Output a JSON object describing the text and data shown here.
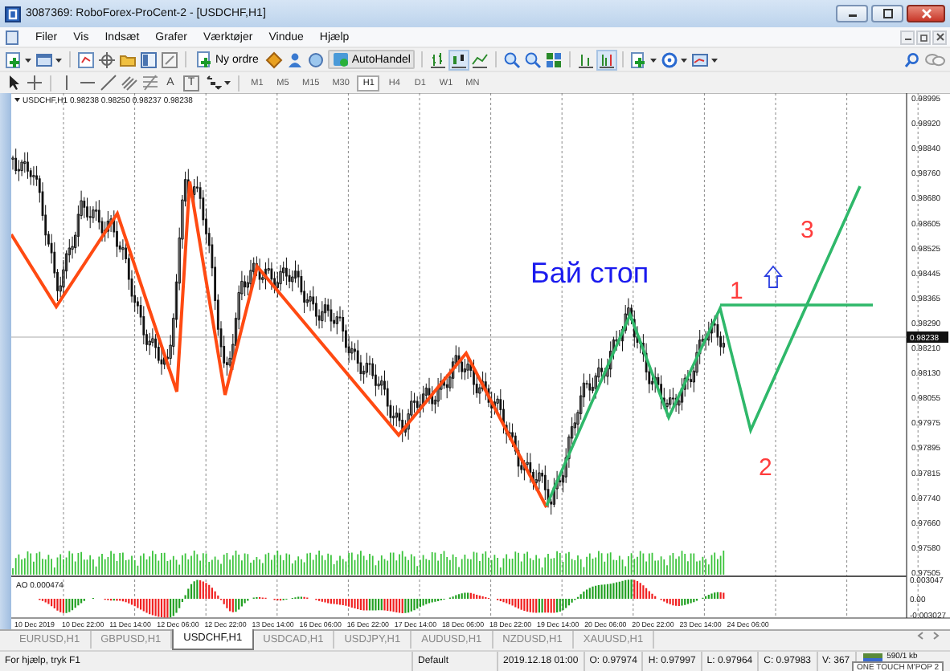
{
  "window": {
    "title": "3087369: RoboForex-ProCent-2 - [USDCHF,H1]"
  },
  "menu": [
    "Filer",
    "Vis",
    "Indsæt",
    "Grafer",
    "Værktøjer",
    "Vindue",
    "Hjælp"
  ],
  "toolbar": {
    "new_order": "Ny ordre",
    "auto_trading": "AutoHandel",
    "text_tools": [
      "A",
      "T"
    ]
  },
  "timeframes": [
    {
      "label": "M1",
      "selected": false
    },
    {
      "label": "M5",
      "selected": false
    },
    {
      "label": "M15",
      "selected": false
    },
    {
      "label": "M30",
      "selected": false
    },
    {
      "label": "H1",
      "selected": true
    },
    {
      "label": "H4",
      "selected": false
    },
    {
      "label": "D1",
      "selected": false
    },
    {
      "label": "W1",
      "selected": false
    },
    {
      "label": "MN",
      "selected": false
    }
  ],
  "chart": {
    "header": "USDCHF,H1 0.98238 0.98250 0.98237 0.98238",
    "price_labels": [
      "0.98995",
      "0.98920",
      "0.98840",
      "0.98760",
      "0.98680",
      "0.98605",
      "0.98525",
      "0.98445",
      "0.98365",
      "0.98290",
      "0.98210",
      "0.98130",
      "0.98055",
      "0.97975",
      "0.97895",
      "0.97815",
      "0.97740",
      "0.97660",
      "0.97580",
      "0.97505"
    ],
    "current_price": "0.98238",
    "caption": "Бай стоп",
    "wave_labels": [
      "1",
      "2",
      "3"
    ],
    "indicator": {
      "label": "AO 0.000474",
      "scale": [
        "0.003047",
        "0.00",
        "-0.003027"
      ]
    },
    "time_labels": [
      "10 Dec 2019",
      "10 Dec 22:00",
      "11 Dec 14:00",
      "12 Dec 06:00",
      "12 Dec 22:00",
      "13 Dec 14:00",
      "16 Dec 06:00",
      "16 Dec 22:00",
      "17 Dec 14:00",
      "18 Dec 06:00",
      "18 Dec 22:00",
      "19 Dec 14:00",
      "20 Dec 06:00",
      "20 Dec 22:00",
      "23 Dec 14:00",
      "24 Dec 06:00"
    ]
  },
  "tabs": [
    {
      "label": "EURUSD,H1",
      "selected": false
    },
    {
      "label": "GBPUSD,H1",
      "selected": false
    },
    {
      "label": "USDCHF,H1",
      "selected": true
    },
    {
      "label": "USDCAD,H1",
      "selected": false
    },
    {
      "label": "USDJPY,H1",
      "selected": false
    },
    {
      "label": "AUDUSD,H1",
      "selected": false
    },
    {
      "label": "NZDUSD,H1",
      "selected": false
    },
    {
      "label": "XAUUSD,H1",
      "selected": false
    }
  ],
  "status_bar": {
    "help": "For hjælp, tryk F1",
    "profile": "Default",
    "cells": [
      "2019.12.18 01:00",
      "O: 0.97974",
      "H: 0.97997",
      "L: 0.97964",
      "C: 0.97983",
      "V: 367"
    ],
    "connection": "590/1 kb",
    "tooltip": "ONE TOUCH M'POP 2"
  }
}
